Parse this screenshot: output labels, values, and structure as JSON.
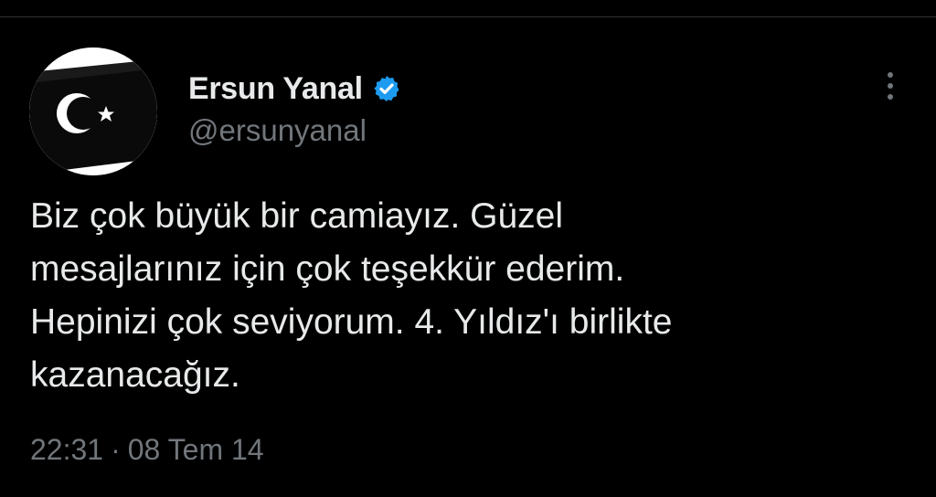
{
  "tweet": {
    "author": {
      "display_name": "Ersun Yanal",
      "handle": "@ersunyanal",
      "verified_icon": "verified-badge-icon",
      "avatar_icon": "crescent-star-flag-avatar"
    },
    "text": "Biz çok büyük bir camiayız. Güzel\nmesajlarınız için çok teşekkür ederim.\nHepinizi çok seviyorum. 4. Yıldız'ı birlikte\nkazanacağız.",
    "time": "22:31",
    "separator": "·",
    "date": "08 Tem 14",
    "more_icon": "more-vertical-icon"
  },
  "colors": {
    "background": "#000000",
    "text": "#e7e9ea",
    "secondary_text": "#71767b",
    "verified_blue": "#1d9bf0"
  }
}
